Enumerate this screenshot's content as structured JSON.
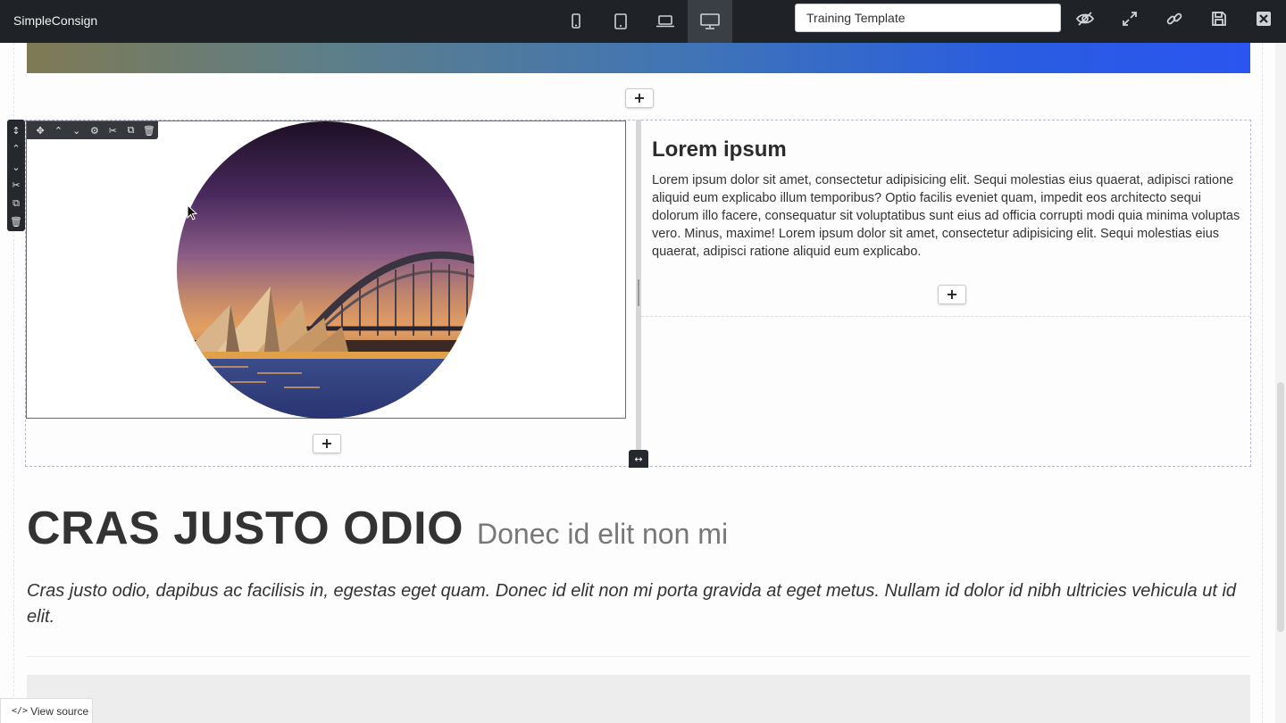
{
  "app": {
    "name": "SimpleConsign"
  },
  "toolbar": {
    "devices": [
      {
        "name": "mobile-icon",
        "active": false
      },
      {
        "name": "tablet-icon",
        "active": false
      },
      {
        "name": "laptop-icon",
        "active": false
      },
      {
        "name": "desktop-icon",
        "active": true
      }
    ],
    "template_name": "Training Template",
    "tools": [
      "preview-hidden-icon",
      "fullscreen-icon",
      "link-icon",
      "save-icon",
      "close-icon"
    ]
  },
  "content": {
    "lorem": {
      "title": "Lorem ipsum",
      "body": "Lorem ipsum dolor sit amet, consectetur adipisicing elit. Sequi molestias eius quaerat, adipisci ratione aliquid eum explicabo illum temporibus? Optio facilis eveniet quam, impedit eos architecto sequi dolorum illo facere, consequatur sit voluptatibus sunt eius ad officia corrupti modi quia minima voluptas vero. Minus, maxime! Lorem ipsum dolor sit amet, consectetur adipisicing elit. Sequi molestias eius quaerat, adipisci ratione aliquid eum explicabo."
    },
    "heading": {
      "main": "CRAS JUSTO ODIO",
      "sub": "Donec id elit non mi"
    },
    "lead": "Cras justo odio, dapibus ac facilisis in, egestas eget quam. Donec id elit non mi porta gravida at eget metus. Nullam id dolor id nibh ultricies vehicula ut id elit.",
    "add_label": "+"
  },
  "row_toolbar": [
    "↕",
    "⌃",
    "⌄",
    "✂",
    "⧉",
    "🗑"
  ],
  "col_toolbar": [
    "✥",
    "⌃",
    "⌄",
    "⚙",
    "✂",
    "⧉",
    "🗑"
  ],
  "resize_handle": "↔",
  "footer": {
    "view_source_code": "</>",
    "view_source": "View source"
  },
  "colors": {
    "topbar": "#1f2327",
    "accent_blue": "#2b55f0"
  }
}
